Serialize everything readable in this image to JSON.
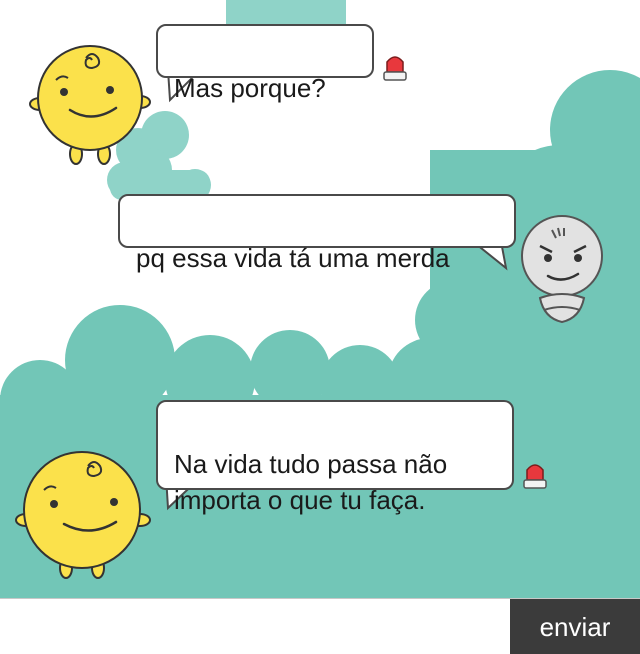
{
  "conversation": {
    "messages": [
      {
        "sender": "simsimi",
        "text": "Mas porque?"
      },
      {
        "sender": "user",
        "text": "pq essa vida tá uma merda"
      },
      {
        "sender": "simsimi",
        "text": "Na vida tudo passa não\nimporta o que tu faça."
      }
    ],
    "report_icon": "siren-report-icon"
  },
  "input": {
    "value": "",
    "placeholder": ""
  },
  "send_button": {
    "label": "enviar"
  },
  "colors": {
    "cloud": "#72c6b7",
    "cloud_light": "#8fd3c8",
    "character_yellow": "#fbe14b",
    "character_gray": "#e2e2e2",
    "siren_red": "#e8383d",
    "send_button_bg": "#3b3b3b"
  }
}
